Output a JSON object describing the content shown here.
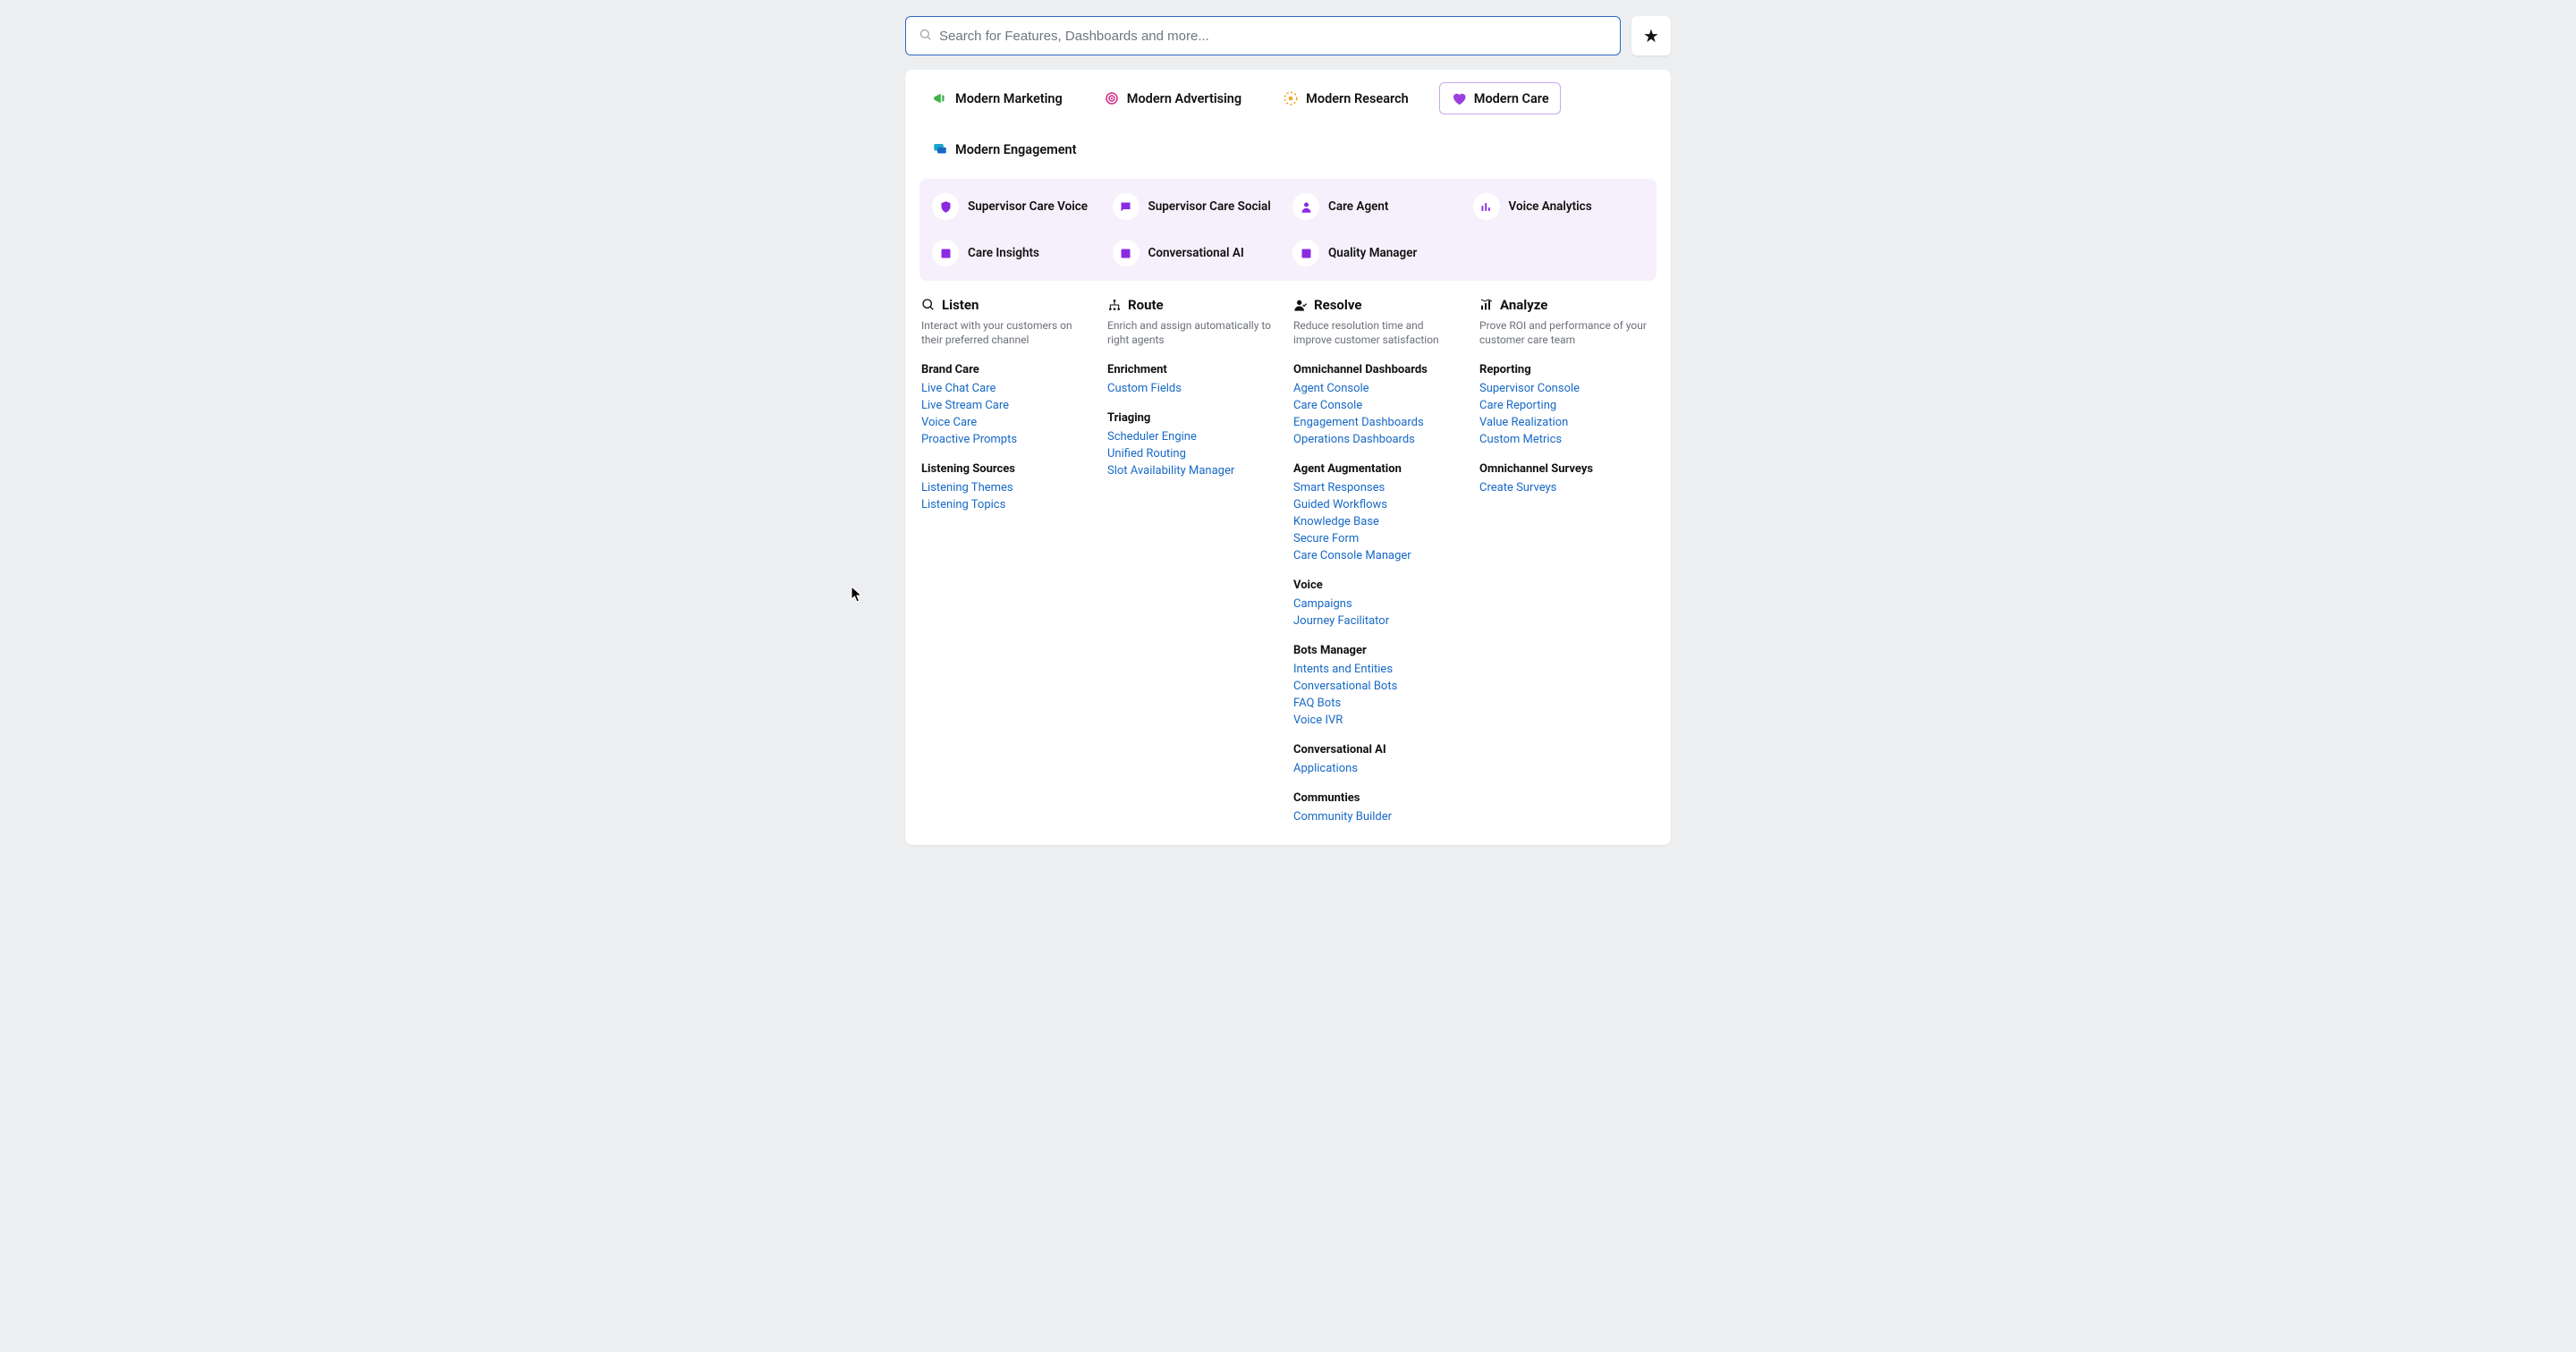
{
  "search": {
    "placeholder": "Search for Features, Dashboards and more..."
  },
  "tabs": [
    {
      "label": "Modern Marketing"
    },
    {
      "label": "Modern Advertising"
    },
    {
      "label": "Modern Research"
    },
    {
      "label": "Modern Care"
    },
    {
      "label": "Modern Engagement"
    }
  ],
  "accent": [
    {
      "label": "Supervisor Care Voice"
    },
    {
      "label": "Supervisor Care Social"
    },
    {
      "label": "Care Agent"
    },
    {
      "label": "Voice Analytics"
    },
    {
      "label": "Care Insights"
    },
    {
      "label": "Conversational AI"
    },
    {
      "label": "Quality Manager"
    }
  ],
  "columns": {
    "listen": {
      "title": "Listen",
      "desc": "Interact with your customers on their preferred channel",
      "groups": [
        {
          "title": "Brand Care",
          "links": [
            "Live Chat Care",
            "Live Stream Care",
            "Voice Care",
            "Proactive Prompts"
          ]
        },
        {
          "title": "Listening Sources",
          "links": [
            "Listening Themes",
            "Listening Topics"
          ]
        }
      ]
    },
    "route": {
      "title": "Route",
      "desc": "Enrich and assign automatically to right agents",
      "groups": [
        {
          "title": "Enrichment",
          "links": [
            "Custom Fields"
          ]
        },
        {
          "title": "Triaging",
          "links": [
            "Scheduler Engine",
            "Unified Routing",
            "Slot Availability Manager"
          ]
        }
      ]
    },
    "resolve": {
      "title": "Resolve",
      "desc": "Reduce resolution time and improve customer satisfaction",
      "groups": [
        {
          "title": "Omnichannel Dashboards",
          "links": [
            "Agent Console",
            "Care Console",
            "Engagement Dashboards",
            "Operations Dashboards"
          ]
        },
        {
          "title": "Agent Augmentation",
          "links": [
            "Smart Responses",
            "Guided Workflows",
            "Knowledge Base",
            "Secure Form",
            "Care Console Manager"
          ]
        },
        {
          "title": "Voice",
          "links": [
            "Campaigns",
            "Journey Facilitator"
          ]
        },
        {
          "title": "Bots Manager",
          "links": [
            "Intents and Entities",
            "Conversational Bots",
            "FAQ Bots",
            "Voice IVR"
          ]
        },
        {
          "title": "Conversational AI",
          "links": [
            "Applications"
          ]
        },
        {
          "title": "Communties",
          "links": [
            "Community Builder"
          ]
        }
      ]
    },
    "analyze": {
      "title": "Analyze",
      "desc": "Prove ROI and performance of your customer care team",
      "groups": [
        {
          "title": "Reporting",
          "links": [
            "Supervisor Console",
            "Care Reporting",
            "Value Realization",
            "Custom Metrics"
          ]
        },
        {
          "title": "Omnichannel Surveys",
          "links": [
            "Create Surveys"
          ]
        }
      ]
    }
  }
}
